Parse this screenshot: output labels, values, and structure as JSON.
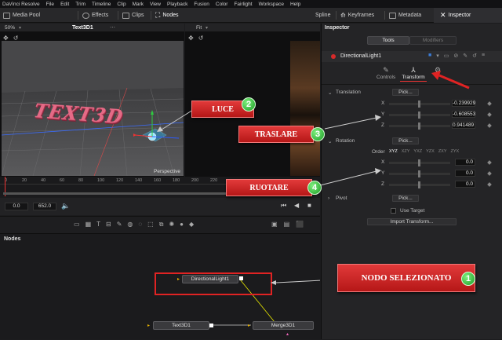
{
  "menubar": {
    "items": [
      "DaVinci Resolve",
      "File",
      "Edit",
      "Trim",
      "Timeline",
      "Clip",
      "Mark",
      "View",
      "Playback",
      "Fusion",
      "Color",
      "Fairlight",
      "Workspace",
      "Help"
    ]
  },
  "toolbar": {
    "media_pool": "Media Pool",
    "effects": "Effects",
    "clips": "Clips",
    "nodes": "Nodes",
    "spline": "Spline",
    "keyframes": "Keyframes",
    "metadata": "Metadata",
    "inspector": "Inspector"
  },
  "viewer_left": {
    "zoom": "50%",
    "title": "Text3D1",
    "scene_text": "TEXT3D",
    "camera_label": "Perspective"
  },
  "viewer_right": {
    "zoom": "Fit"
  },
  "timeline": {
    "ticks": [
      "0",
      "20",
      "40",
      "60",
      "80",
      "100",
      "120",
      "140",
      "160",
      "180",
      "200",
      "220"
    ]
  },
  "transport": {
    "start": "0.0",
    "end": "652.0"
  },
  "nodes_panel": {
    "title": "Nodes",
    "node_light": "DirectionalLight1",
    "node_text": "Text3D1",
    "node_merge": "Merge3D1"
  },
  "inspector": {
    "title": "Inspector",
    "tab_tools": "Tools",
    "tab_modifiers": "Modifiers",
    "node_name": "DirectionalLight1",
    "subtab_controls": "Controls",
    "subtab_transform": "Transform",
    "translation": {
      "label": "Translation",
      "pick": "Pick...",
      "x_label": "X",
      "x_value": "-0.239929",
      "y_label": "Y",
      "y_value": "-0.608553",
      "z_label": "Z",
      "z_value": "0.941489"
    },
    "rotation": {
      "label": "Rotation",
      "pick": "Pick...",
      "order_label": "Order",
      "orders": [
        "XYZ",
        "XZY",
        "YXZ",
        "YZX",
        "ZXY",
        "ZYX"
      ],
      "x_label": "X",
      "x_value": "0.0",
      "y_label": "Y",
      "y_value": "0.0",
      "z_label": "Z",
      "z_value": "0.0"
    },
    "pivot": {
      "label": "Pivot",
      "pick": "Pick..."
    },
    "use_target": "Use Target",
    "import_transform": "Import Transform..."
  },
  "annotations": {
    "luce": "LUCE",
    "luce_num": "2",
    "traslare": "TRASLARE",
    "traslare_num": "3",
    "ruotare": "RUOTARE",
    "ruotare_num": "4",
    "nodo": "NODO SELEZIONATO",
    "nodo_num": "1"
  },
  "colors": {
    "accent_red": "#d62a2a",
    "badge_green": "#2fbf3a",
    "text3d_pink": "#e56a86"
  }
}
